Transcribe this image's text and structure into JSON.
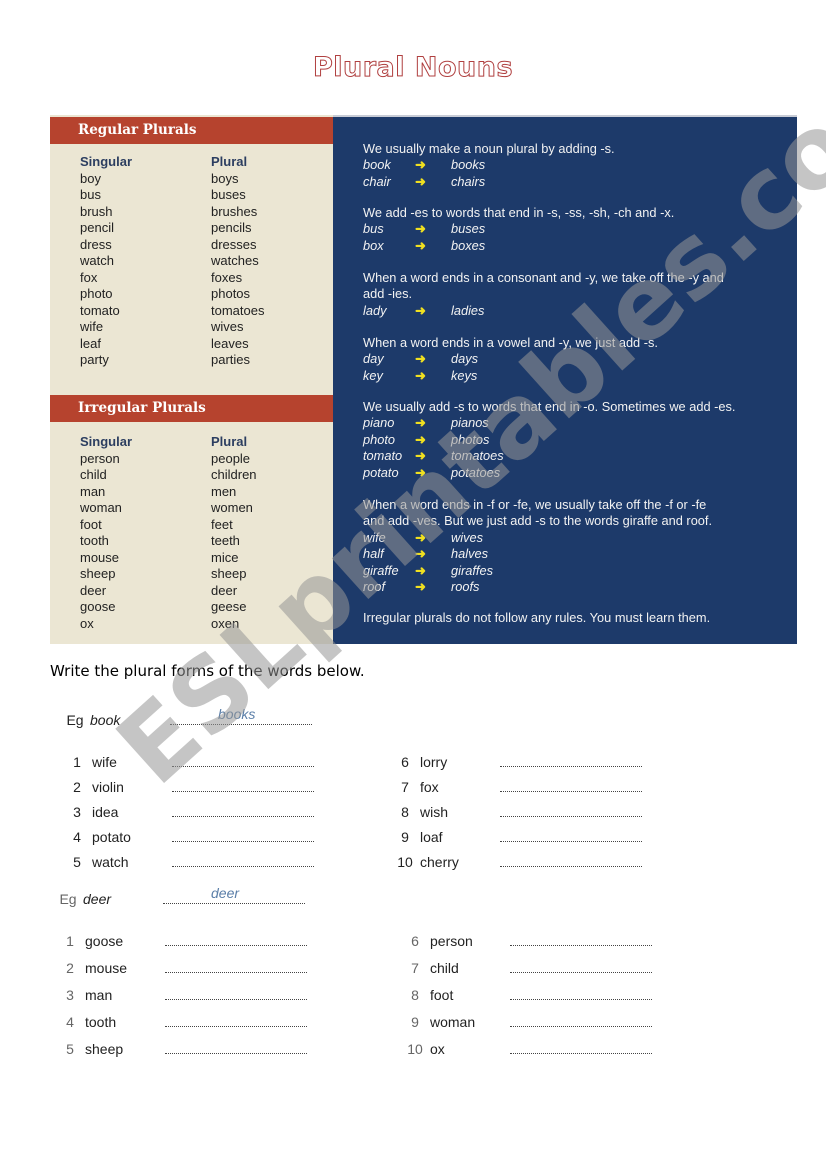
{
  "title": "Plural Nouns",
  "reference": {
    "regular": {
      "heading": "Regular Plurals",
      "col_singular": "Singular",
      "col_plural": "Plural",
      "singular": [
        "boy",
        "bus",
        "brush",
        "pencil",
        "dress",
        "watch",
        "fox",
        "photo",
        "tomato",
        "wife",
        "leaf",
        "party"
      ],
      "plural": [
        "boys",
        "buses",
        "brushes",
        "pencils",
        "dresses",
        "watches",
        "foxes",
        "photos",
        "tomatoes",
        "wives",
        "leaves",
        "parties"
      ]
    },
    "irregular": {
      "heading": "Irregular Plurals",
      "col_singular": "Singular",
      "col_plural": "Plural",
      "singular": [
        "person",
        "child",
        "man",
        "woman",
        "foot",
        "tooth",
        "mouse",
        "sheep",
        "deer",
        "goose",
        "ox"
      ],
      "plural": [
        "people",
        "children",
        "men",
        "women",
        "feet",
        "teeth",
        "mice",
        "sheep",
        "deer",
        "geese",
        "oxen"
      ]
    },
    "rules": [
      {
        "text": [
          "We usually make a noun plural by adding -s."
        ],
        "examples": [
          [
            "book",
            "books"
          ],
          [
            "chair",
            "chairs"
          ]
        ]
      },
      {
        "text": [
          "We add -es to words that end in -s, -ss, -sh, -ch and -x."
        ],
        "examples": [
          [
            "bus",
            "buses"
          ],
          [
            "box",
            "boxes"
          ]
        ]
      },
      {
        "text": [
          "When a word ends in a consonant and -y, we take off the -y and",
          "add -ies."
        ],
        "examples": [
          [
            "lady",
            "ladies"
          ]
        ]
      },
      {
        "text": [
          "When a word ends in a vowel and -y, we just add -s."
        ],
        "examples": [
          [
            "day",
            "days"
          ],
          [
            "key",
            "keys"
          ]
        ]
      },
      {
        "text": [
          "We usually add -s to words that end in -o. Sometimes we add -es."
        ],
        "examples": [
          [
            "piano",
            "pianos"
          ],
          [
            "photo",
            "photos"
          ],
          [
            "tomato",
            "tomatoes"
          ],
          [
            "potato",
            "potatoes"
          ]
        ]
      },
      {
        "text": [
          "When a word ends in -f or -fe, we usually take off the -f or -fe",
          "and add -ves. But we just add -s to the words giraffe and roof."
        ],
        "examples": [
          [
            "wife",
            "wives"
          ],
          [
            "half",
            "halves"
          ],
          [
            "giraffe",
            "giraffes"
          ],
          [
            "roof",
            "roofs"
          ]
        ]
      },
      {
        "text": [
          "Irregular plurals do not follow any rules. You must learn them."
        ],
        "examples": []
      }
    ],
    "arrow": "➜"
  },
  "exercise": {
    "instruction": "Write the plural forms of the words below.",
    "set1": {
      "example": {
        "label": "Eg",
        "word": "book",
        "answer": "books"
      },
      "items": [
        {
          "n": "1",
          "word": "wife"
        },
        {
          "n": "2",
          "word": "violin"
        },
        {
          "n": "3",
          "word": "idea"
        },
        {
          "n": "4",
          "word": "potato"
        },
        {
          "n": "5",
          "word": "watch"
        },
        {
          "n": "6",
          "word": "lorry"
        },
        {
          "n": "7",
          "word": "fox"
        },
        {
          "n": "8",
          "word": "wish"
        },
        {
          "n": "9",
          "word": "loaf"
        },
        {
          "n": "10",
          "word": "cherry"
        }
      ]
    },
    "set2": {
      "example": {
        "label": "Eg",
        "word": "deer",
        "answer": "deer"
      },
      "items": [
        {
          "n": "1",
          "word": "goose"
        },
        {
          "n": "2",
          "word": "mouse"
        },
        {
          "n": "3",
          "word": "man"
        },
        {
          "n": "4",
          "word": "tooth"
        },
        {
          "n": "5",
          "word": "sheep"
        },
        {
          "n": "6",
          "word": "person"
        },
        {
          "n": "7",
          "word": "child"
        },
        {
          "n": "8",
          "word": "foot"
        },
        {
          "n": "9",
          "word": "woman"
        },
        {
          "n": "10",
          "word": "ox"
        }
      ]
    }
  },
  "watermark": "ESLprintables.com"
}
